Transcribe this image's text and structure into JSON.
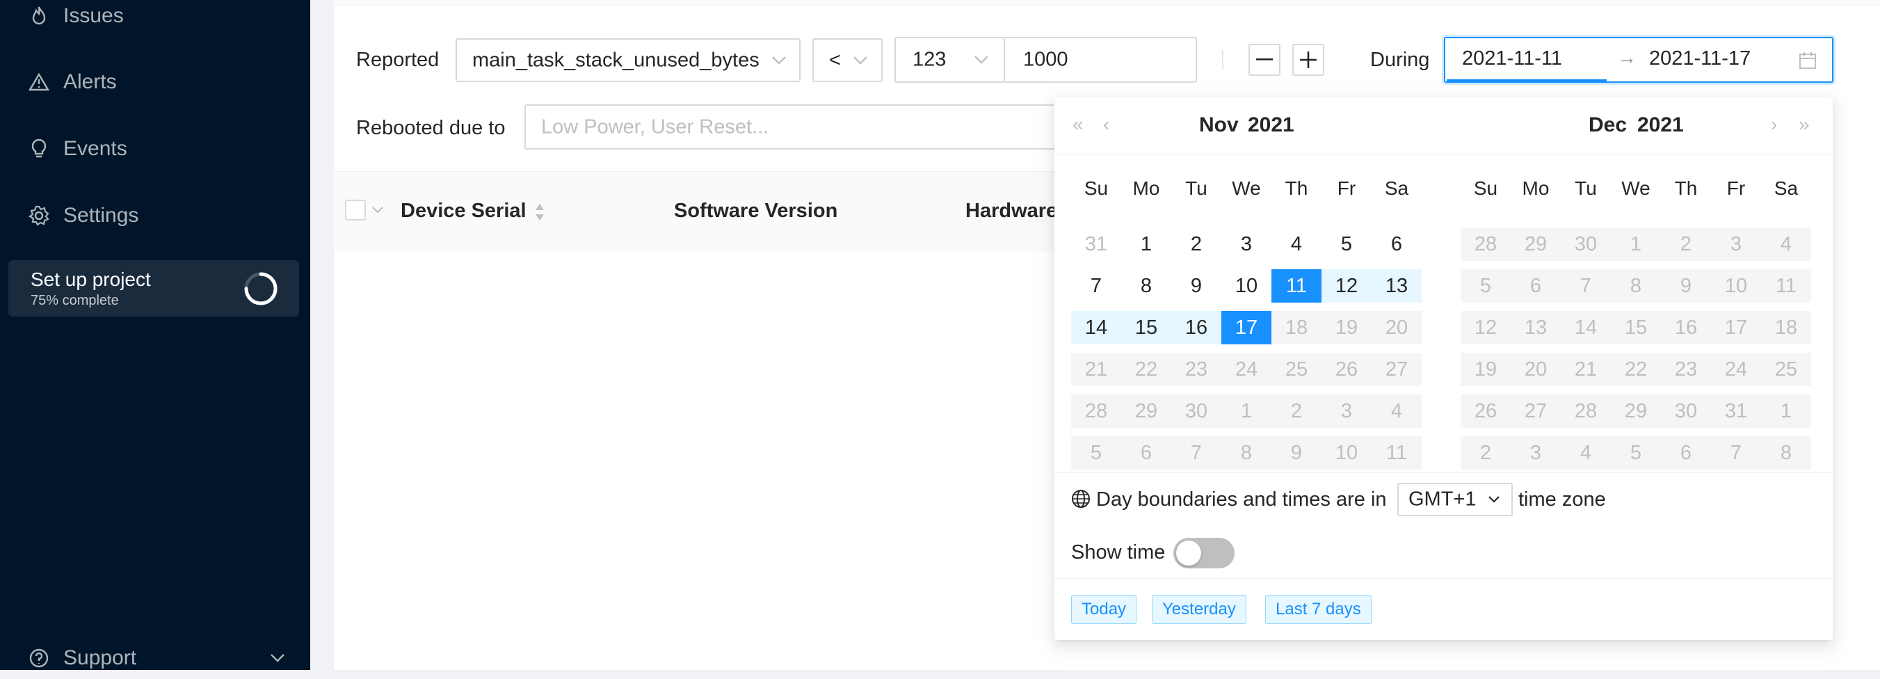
{
  "sidebar": {
    "items": [
      {
        "label": "Issues",
        "icon": "fire-icon"
      },
      {
        "label": "Alerts",
        "icon": "alert-icon"
      },
      {
        "label": "Events",
        "icon": "bulb-icon"
      },
      {
        "label": "Settings",
        "icon": "gear-icon"
      }
    ],
    "project": {
      "title": "Set up project",
      "subtitle": "75% complete",
      "progress": 0.75
    },
    "support": {
      "label": "Support"
    }
  },
  "filters": {
    "reported_label": "Reported",
    "metric_value": "main_task_stack_unused_bytes",
    "operator_value": "<",
    "type_value": "123",
    "threshold_value": "1000",
    "during_label": "During",
    "range_start": "2021-11-11",
    "range_arrow": "→",
    "range_end": "2021-11-17",
    "rebooted_label": "Rebooted due to",
    "rebooted_placeholder": "Low Power, User Reset..."
  },
  "table": {
    "columns": [
      "Device Serial",
      "Software Version",
      "Hardware"
    ]
  },
  "picker": {
    "nav_prev_year": "«",
    "nav_prev_month": "‹",
    "nav_next_month": "›",
    "nav_next_year": "»",
    "weekdays": [
      "Su",
      "Mo",
      "Tu",
      "We",
      "Th",
      "Fr",
      "Sa"
    ],
    "left": {
      "month": "Nov",
      "year": "2021",
      "days": [
        [
          "31",
          "1",
          "2",
          "3",
          "4",
          "5",
          "6"
        ],
        [
          "7",
          "8",
          "9",
          "10",
          "11",
          "12",
          "13"
        ],
        [
          "14",
          "15",
          "16",
          "17",
          "18",
          "19",
          "20"
        ],
        [
          "21",
          "22",
          "23",
          "24",
          "25",
          "26",
          "27"
        ],
        [
          "28",
          "29",
          "30",
          "1",
          "2",
          "3",
          "4"
        ],
        [
          "5",
          "6",
          "7",
          "8",
          "9",
          "10",
          "11"
        ]
      ]
    },
    "right": {
      "month": "Dec",
      "year": "2021",
      "days": [
        [
          "28",
          "29",
          "30",
          "1",
          "2",
          "3",
          "4"
        ],
        [
          "5",
          "6",
          "7",
          "8",
          "9",
          "10",
          "11"
        ],
        [
          "12",
          "13",
          "14",
          "15",
          "16",
          "17",
          "18"
        ],
        [
          "19",
          "20",
          "21",
          "22",
          "23",
          "24",
          "25"
        ],
        [
          "26",
          "27",
          "28",
          "29",
          "30",
          "31",
          "1"
        ],
        [
          "2",
          "3",
          "4",
          "5",
          "6",
          "7",
          "8"
        ]
      ]
    },
    "timezone_prefix": "Day boundaries and times are in",
    "timezone_value": "GMT+1",
    "timezone_suffix": "time zone",
    "show_time_label": "Show time",
    "show_time_on": false,
    "presets": [
      "Today",
      "Yesterday",
      "Last 7 days"
    ]
  },
  "colors": {
    "sidebar_bg": "#001529",
    "accent": "#1890ff",
    "range_bg": "#e6f7ff"
  }
}
